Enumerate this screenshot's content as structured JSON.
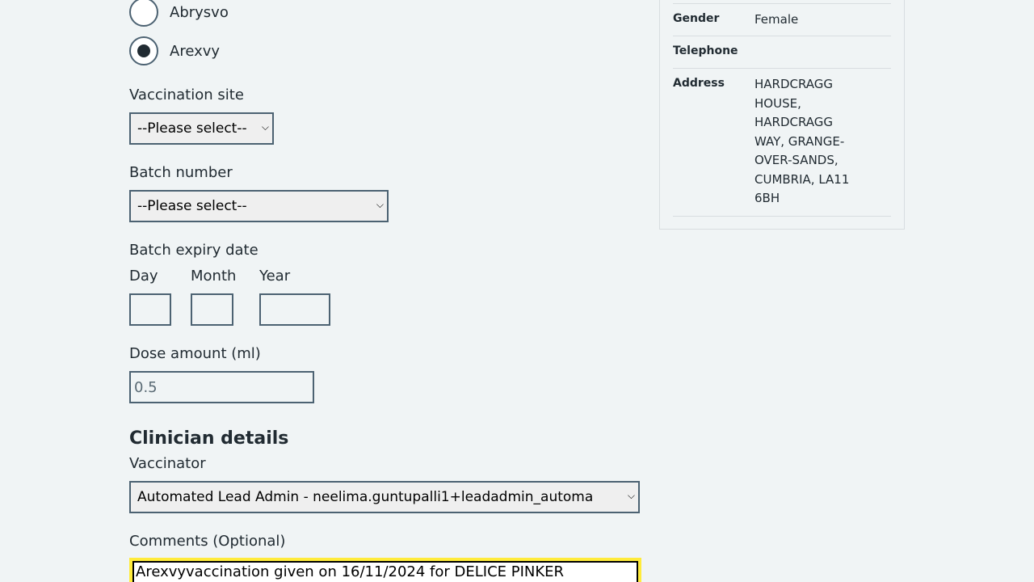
{
  "vaccine_options": [
    {
      "label": "Abrysvo",
      "checked": false
    },
    {
      "label": "Arexvy",
      "checked": true
    }
  ],
  "vaccination_site": {
    "label": "Vaccination site",
    "value": "--Please select--"
  },
  "batch_number": {
    "label": "Batch number",
    "value": "--Please select--"
  },
  "batch_expiry": {
    "label": "Batch expiry date",
    "day_label": "Day",
    "month_label": "Month",
    "year_label": "Year",
    "day_value": "",
    "month_value": "",
    "year_value": ""
  },
  "dose_amount": {
    "label": "Dose amount (ml)",
    "value": "0.5"
  },
  "clinician": {
    "heading": "Clinician details",
    "vaccinator_label": "Vaccinator",
    "vaccinator_value": "Automated Lead Admin - neelima.guntupalli1+leadadmin_automa"
  },
  "comments": {
    "label": "Comments (Optional)",
    "value": "Arexvyvaccination given on 16/11/2024 for DELICE PINKER"
  },
  "patient_details": {
    "gender_label": "Gender",
    "gender_value": "Female",
    "telephone_label": "Telephone",
    "telephone_value": "",
    "address_label": "Address",
    "address_value": "HARDCRAGG HOUSE, HARDCRAGG WAY, GRANGE-OVER-SANDS, CUMBRIA, LA11 6BH"
  },
  "colors": {
    "page_background": "#f0f4f5",
    "border": "#4c6272",
    "focus": "#ffeb3b",
    "text": "#212b32"
  }
}
